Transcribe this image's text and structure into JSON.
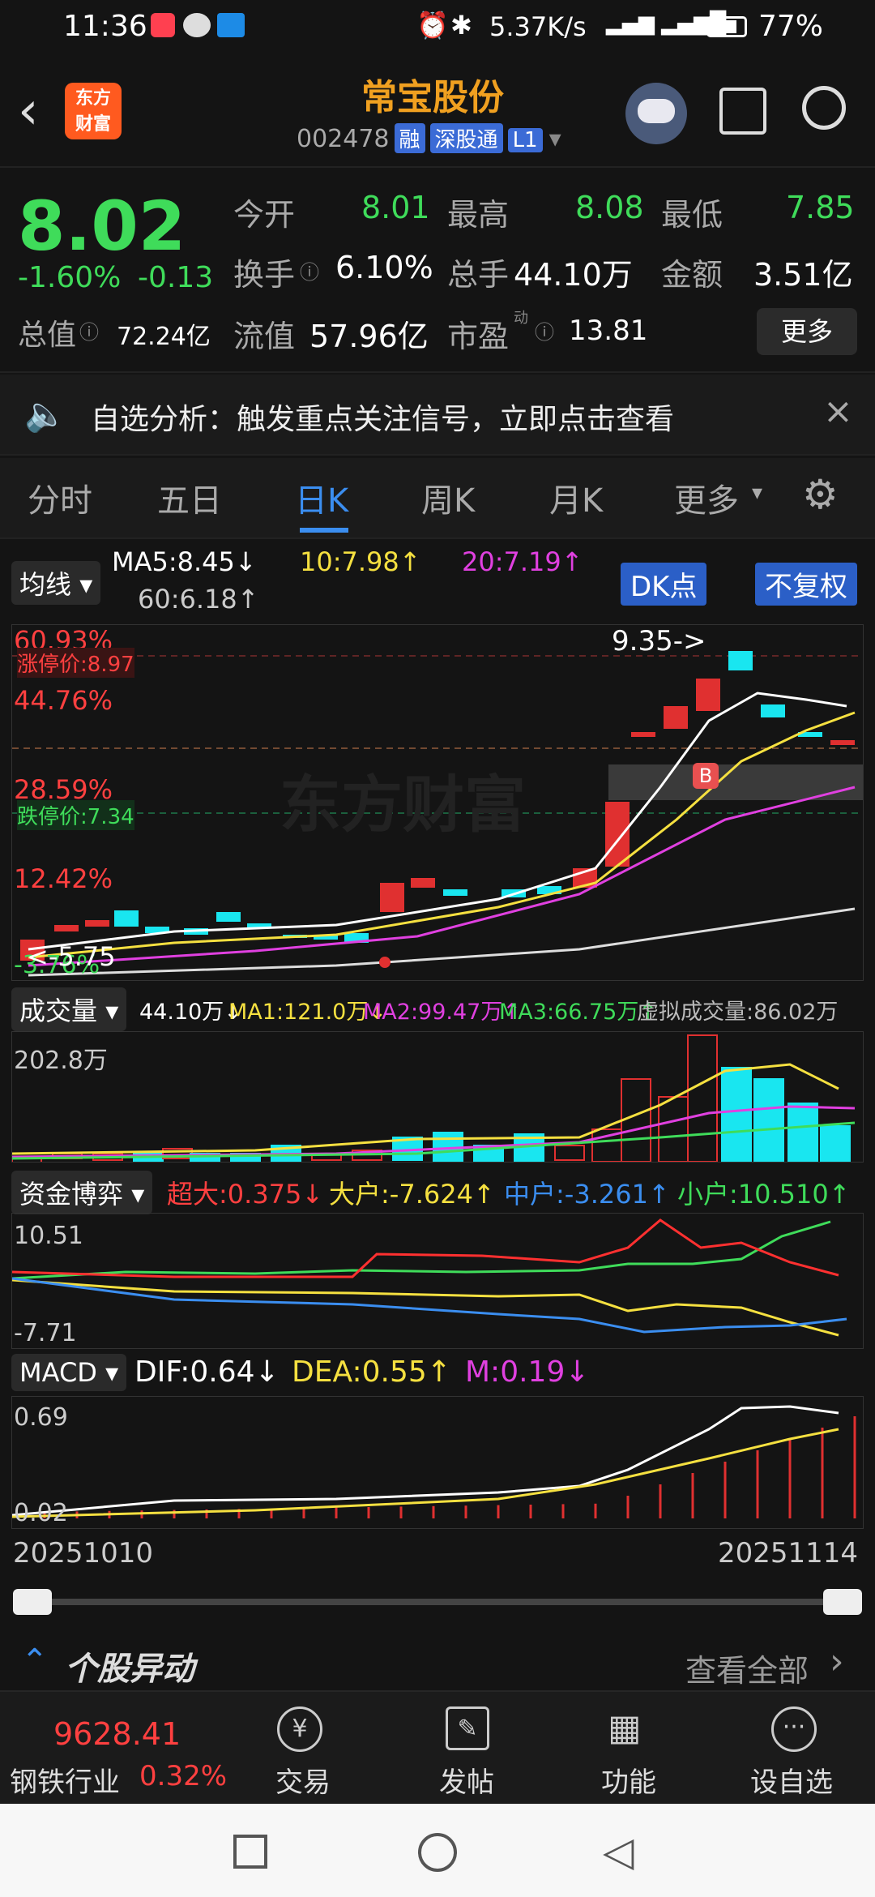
{
  "status": {
    "time": "11:36",
    "speed": "5.37K/s",
    "battery": "77%"
  },
  "header": {
    "title": "常宝股份",
    "code": "002478",
    "tag1": "融",
    "tag2": "深股通",
    "tag3": "L1",
    "logo_line1": "东方",
    "logo_line2": "财富"
  },
  "quote": {
    "price": "8.02",
    "pct": "-1.60%",
    "chg": "-0.13",
    "open_label": "今开",
    "open": "8.01",
    "high_label": "最高",
    "high": "8.08",
    "low_label": "最低",
    "low": "7.85",
    "turnover_label": "换手",
    "turnover": "6.10%",
    "vol_label": "总手",
    "vol": "44.10万",
    "amt_label": "金额",
    "amt": "3.51亿",
    "mcap_label": "总值",
    "mcap": "72.24亿",
    "float_label": "流值",
    "float": "57.96亿",
    "pe_label": "市盈",
    "pe_sup": "动",
    "pe": "13.81",
    "more": "更多"
  },
  "banner": {
    "text": "自选分析：触发重点关注信号，立即点击查看"
  },
  "tabs": [
    "分时",
    "五日",
    "日K",
    "周K",
    "月K",
    "更多"
  ],
  "ma": {
    "label": "均线",
    "ma5": "MA5:8.45↓",
    "ma10": "10:7.98↑",
    "ma20": "20:7.19↑",
    "ma60": "60:6.18↑",
    "dk": "DK点",
    "fq": "不复权"
  },
  "kchart": {
    "y1": "60.93%",
    "limitup": "涨停价:8.97",
    "y2": "44.76%",
    "y3": "28.59%",
    "limitdown": "跌停价:7.34",
    "y4": "12.42%",
    "y5": "-3.76%",
    "hi_label": "9.35->",
    "lo_label": "<-5.75",
    "b": "B",
    "watermark": "东方财富"
  },
  "volume": {
    "label": "成交量",
    "v": "44.10万↓",
    "ma1": "MA1:121.0万↓",
    "ma2": "MA2:99.47万↑",
    "ma3": "MA3:66.75万↑",
    "virt": "虚拟成交量:86.02万",
    "ymax": "202.8万"
  },
  "fund": {
    "label": "资金博弈",
    "super": "超大:0.375↓",
    "big": "大户:-7.624↑",
    "mid": "中户:-3.261↑",
    "small": "小户:10.510↑",
    "ymax": "10.51",
    "ymin": "-7.71"
  },
  "macd": {
    "label": "MACD",
    "dif": "DIF:0.64↓",
    "dea": "DEA:0.55↑",
    "m": "M:0.19↓",
    "ymax": "0.69",
    "ymin": "0.02",
    "d1": "20251010",
    "d2": "20251114"
  },
  "movers": {
    "title": "个股异动",
    "all": "查看全部"
  },
  "bottom": {
    "index": "9628.41",
    "sector": "钢铁行业",
    "sector_pct": "0.32%",
    "trade": "交易",
    "post": "发帖",
    "func": "功能",
    "watch": "设自选"
  },
  "colors": {
    "up": "#ff4040",
    "down": "#3fdc5a",
    "accent": "#f0a020",
    "cyan": "#19e6f0"
  }
}
